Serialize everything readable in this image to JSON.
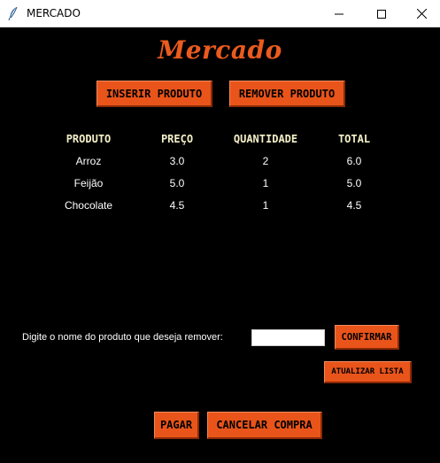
{
  "window": {
    "title": "MERCADO"
  },
  "app": {
    "heading": "Mercado"
  },
  "buttons": {
    "inserir": "INSERIR PRODUTO",
    "remover": "REMOVER PRODUTO",
    "confirmar": "CONFIRMAR",
    "atualizar": "ATUALIZAR LISTA",
    "pagar": "PAGAR",
    "cancelar": "CANCELAR COMPRA"
  },
  "table": {
    "headers": [
      "PRODUTO",
      "PREÇO",
      "QUANTIDADE",
      "TOTAL"
    ],
    "rows": [
      [
        "Arroz",
        "3.0",
        "2",
        "6.0"
      ],
      [
        "Feijão",
        "5.0",
        "1",
        "5.0"
      ],
      [
        "Chocolate",
        "4.5",
        "1",
        "4.5"
      ]
    ]
  },
  "remove_form": {
    "label": "Digite o nome do produto que deseja remover:",
    "value": ""
  },
  "colors": {
    "background": "#000000",
    "accent": "#e9541a",
    "header_text": "#f5f0c8",
    "heading": "#ea5b1f"
  },
  "icons": [
    "feather-icon",
    "minimize-icon",
    "maximize-icon",
    "close-icon"
  ]
}
